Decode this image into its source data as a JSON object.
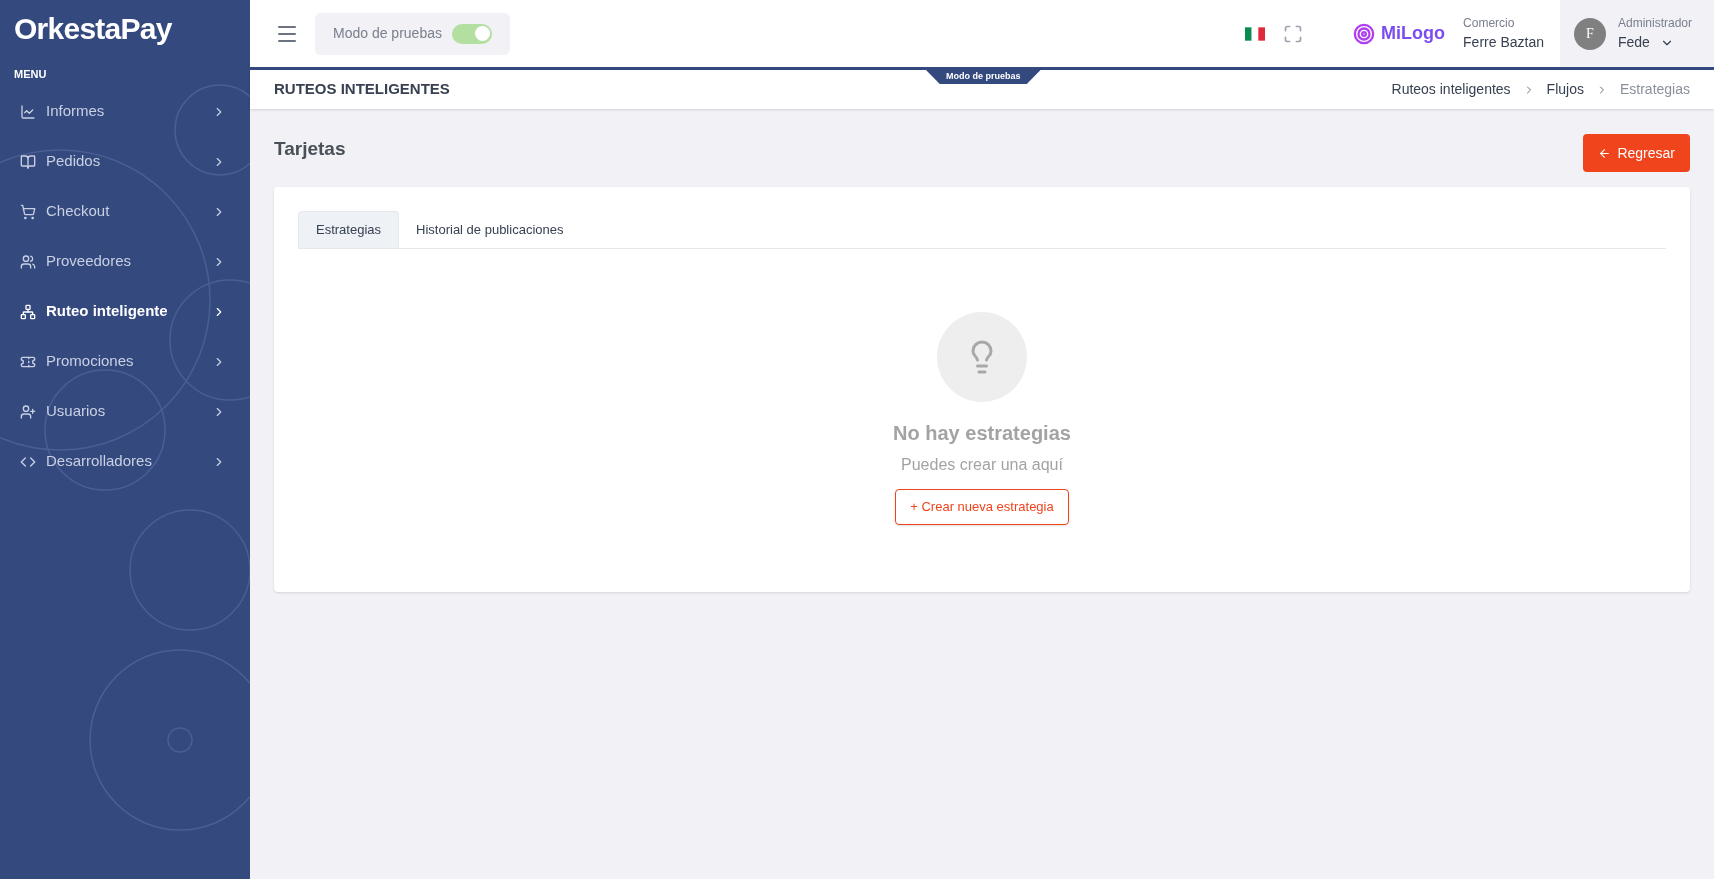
{
  "sidebar": {
    "logo": "OrkestaPay",
    "menu_label": "MENU",
    "items": [
      {
        "label": "Informes",
        "selected": false
      },
      {
        "label": "Pedidos",
        "selected": false
      },
      {
        "label": "Checkout",
        "selected": false
      },
      {
        "label": "Proveedores",
        "selected": false
      },
      {
        "label": "Ruteo inteligente",
        "selected": true
      },
      {
        "label": "Promociones",
        "selected": false
      },
      {
        "label": "Usuarios",
        "selected": false
      },
      {
        "label": "Desarrolladores",
        "selected": false
      }
    ]
  },
  "header": {
    "test_mode": {
      "label": "Modo de pruebas",
      "on": true
    },
    "brand_logo": "MiLogo",
    "merchant": {
      "label": "Comercio",
      "name": "Ferre Baztan"
    },
    "user": {
      "initial": "F",
      "role": "Administrador",
      "name": "Fede"
    }
  },
  "subheader": {
    "title": "RUTEOS INTELIGENTES",
    "ribbon": "Modo de pruebas",
    "breadcrumbs": [
      {
        "label": "Ruteos inteligentes",
        "current": false
      },
      {
        "label": "Flujos",
        "current": false
      },
      {
        "label": "Estrategias",
        "current": true
      }
    ]
  },
  "page": {
    "title": "Tarjetas",
    "back_button": "Regresar",
    "tabs": [
      {
        "label": "Estrategias",
        "selected": true
      },
      {
        "label": "Historial de publicaciones",
        "selected": false
      }
    ],
    "empty_state": {
      "title": "No hay estrategias",
      "subtitle": "Puedes crear una aquí",
      "button": "+ Crear nueva estrategia"
    }
  }
}
